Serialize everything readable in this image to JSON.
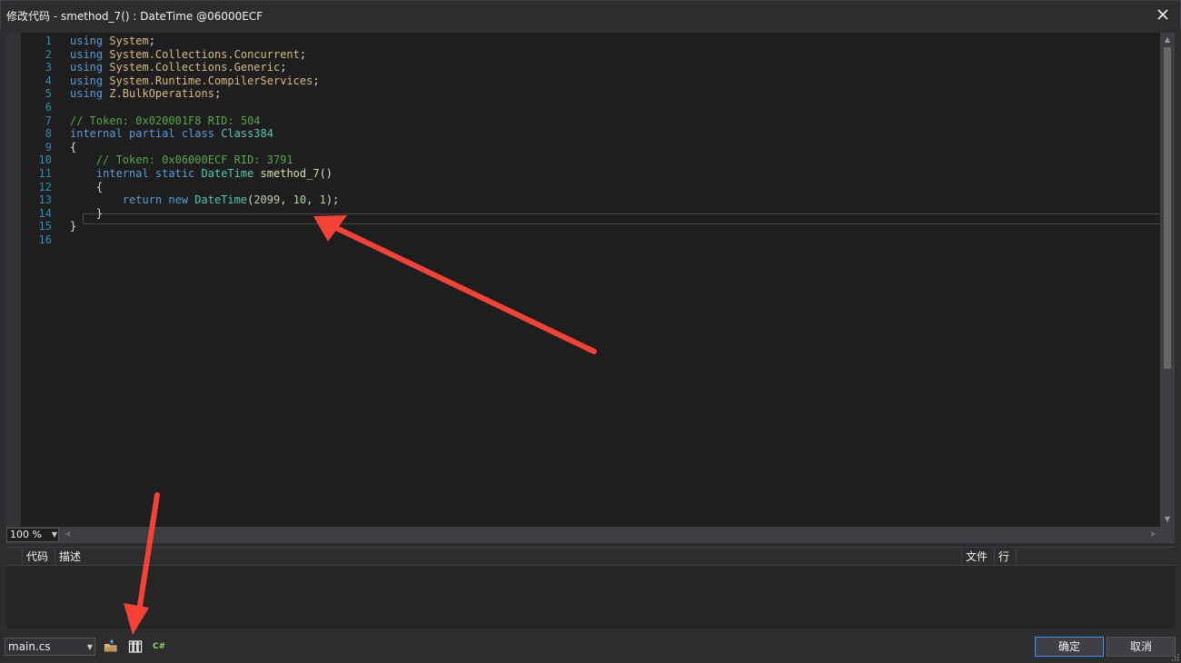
{
  "window": {
    "title": "修改代码 - smethod_7() : DateTime @06000ECF",
    "close_glyph": "✕"
  },
  "editor": {
    "lines": [
      {
        "n": "1",
        "tokens": [
          {
            "c": "kw",
            "t": "using"
          },
          {
            "c": "",
            "t": " "
          },
          {
            "c": "ns",
            "t": "System"
          },
          {
            "c": "",
            "t": ";"
          }
        ]
      },
      {
        "n": "2",
        "tokens": [
          {
            "c": "kw",
            "t": "using"
          },
          {
            "c": "",
            "t": " "
          },
          {
            "c": "ns",
            "t": "System.Collections.Concurrent"
          },
          {
            "c": "",
            "t": ";"
          }
        ]
      },
      {
        "n": "3",
        "tokens": [
          {
            "c": "kw",
            "t": "using"
          },
          {
            "c": "",
            "t": " "
          },
          {
            "c": "ns",
            "t": "System.Collections.Generic"
          },
          {
            "c": "",
            "t": ";"
          }
        ]
      },
      {
        "n": "4",
        "tokens": [
          {
            "c": "kw",
            "t": "using"
          },
          {
            "c": "",
            "t": " "
          },
          {
            "c": "ns",
            "t": "System.Runtime.CompilerServices"
          },
          {
            "c": "",
            "t": ";"
          }
        ]
      },
      {
        "n": "5",
        "tokens": [
          {
            "c": "kw",
            "t": "using"
          },
          {
            "c": "",
            "t": " "
          },
          {
            "c": "ns",
            "t": "Z.BulkOperations"
          },
          {
            "c": "",
            "t": ";"
          }
        ]
      },
      {
        "n": "6",
        "tokens": []
      },
      {
        "n": "7",
        "tokens": [
          {
            "c": "cm",
            "t": "// Token: 0x020001F8 RID: 504"
          }
        ]
      },
      {
        "n": "8",
        "tokens": [
          {
            "c": "kw",
            "t": "internal partial class"
          },
          {
            "c": "",
            "t": " "
          },
          {
            "c": "ty",
            "t": "Class384"
          }
        ]
      },
      {
        "n": "9",
        "tokens": [
          {
            "c": "",
            "t": "{"
          }
        ]
      },
      {
        "n": "10",
        "tokens": [
          {
            "c": "",
            "t": "    "
          },
          {
            "c": "cm",
            "t": "// Token: 0x06000ECF RID: 3791"
          }
        ]
      },
      {
        "n": "11",
        "tokens": [
          {
            "c": "",
            "t": "    "
          },
          {
            "c": "kw",
            "t": "internal static"
          },
          {
            "c": "",
            "t": " "
          },
          {
            "c": "ty",
            "t": "DateTime"
          },
          {
            "c": "",
            "t": " "
          },
          {
            "c": "mt",
            "t": "smethod_7"
          },
          {
            "c": "",
            "t": "()"
          }
        ]
      },
      {
        "n": "12",
        "tokens": [
          {
            "c": "",
            "t": "    {"
          }
        ]
      },
      {
        "n": "13",
        "tokens": [
          {
            "c": "",
            "t": "        "
          },
          {
            "c": "kw",
            "t": "return new"
          },
          {
            "c": "",
            "t": " "
          },
          {
            "c": "ty",
            "t": "DateTime"
          },
          {
            "c": "",
            "t": "("
          },
          {
            "c": "nm",
            "t": "2099"
          },
          {
            "c": "",
            "t": ", "
          },
          {
            "c": "nm",
            "t": "10"
          },
          {
            "c": "",
            "t": ", "
          },
          {
            "c": "nm",
            "t": "1"
          },
          {
            "c": "",
            "t": ");"
          }
        ]
      },
      {
        "n": "14",
        "tokens": [
          {
            "c": "",
            "t": "    }"
          }
        ]
      },
      {
        "n": "15",
        "tokens": [
          {
            "c": "",
            "t": "}"
          }
        ]
      },
      {
        "n": "16",
        "tokens": []
      }
    ],
    "zoom": "100 %"
  },
  "colors": {
    "keyword": "#569cd6",
    "namespace": "#d7ba7d",
    "comment": "#57a64a",
    "type": "#4ec9b0",
    "method": "#dcdcaa",
    "annotation_arrow": "#f44336",
    "accent": "#3399ff"
  },
  "error_list": {
    "columns": [
      "代码",
      "描述",
      "文件",
      "行"
    ]
  },
  "footer": {
    "file_select": "main.cs",
    "csharp_badge": "C#",
    "ok_label": "确定",
    "cancel_label": "取消"
  }
}
